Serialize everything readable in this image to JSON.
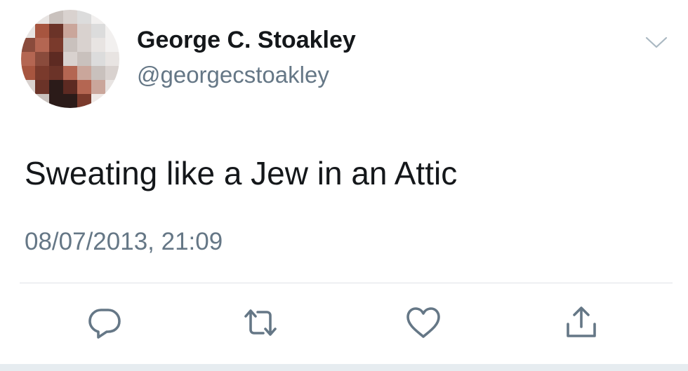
{
  "tweet": {
    "author_name": "George C. Stoakley",
    "author_handle": "@georgecstoakley",
    "text": "Sweating like a Jew in an Attic",
    "timestamp": "08/07/2013, 21:09"
  },
  "icons": {
    "menu": "chevron-down-icon",
    "reply": "reply-icon",
    "retweet": "retweet-icon",
    "like": "heart-icon",
    "share": "share-icon"
  },
  "colors": {
    "primary_text": "#14171a",
    "secondary_text": "#657786",
    "icon": "#657786",
    "divider": "#dfe3e6"
  }
}
